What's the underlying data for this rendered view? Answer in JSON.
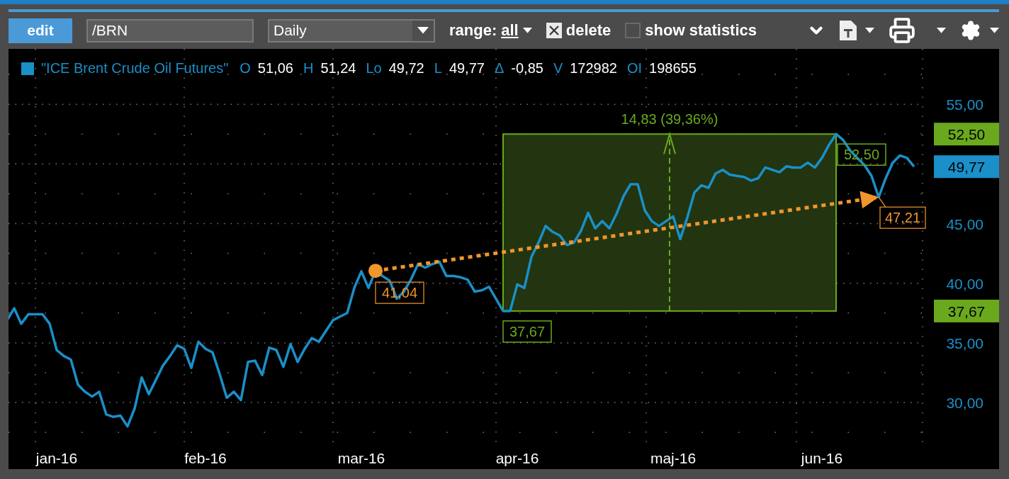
{
  "toolbar": {
    "edit_button": "edit",
    "symbol": {
      "value": "/BRN"
    },
    "interval": {
      "value": "Daily"
    },
    "range": {
      "label": "range:",
      "value": "all"
    },
    "delete": {
      "label": "delete",
      "checked": true
    },
    "show_statistics": {
      "label": "show statistics",
      "checked": false
    }
  },
  "chart": {
    "legend": {
      "color": "#1a8fc8",
      "stats": [
        {
          "key": "O",
          "value": "51,06"
        },
        {
          "key": "H",
          "value": "51,24"
        },
        {
          "key": "Lo",
          "value": "49,72"
        },
        {
          "key": "L",
          "value": "49,77"
        },
        {
          "key": "Δ",
          "value": "-0,85"
        },
        {
          "key": "V",
          "value": "172982"
        },
        {
          "key": "OI",
          "value": "198655"
        }
      ]
    },
    "price_tags": [
      {
        "label": "52,50",
        "color": "#6aa81e"
      },
      {
        "label": "49,77",
        "color": "#1a8fc8"
      },
      {
        "label": "37,67",
        "color": "#6aa81e"
      }
    ],
    "chart_data": {
      "type": "line",
      "grid": true,
      "ylim": [
        26.5,
        59.64
      ],
      "yticks": [
        {
          "value": 30,
          "label": "30,00"
        },
        {
          "value": 35,
          "label": "35,00"
        },
        {
          "value": 40,
          "label": "40,00"
        },
        {
          "value": 45,
          "label": "45,00"
        },
        {
          "value": 55,
          "label": "55,00"
        }
      ],
      "categories": [
        null,
        null,
        null,
        null,
        null,
        null,
        null,
        "jan-16",
        null,
        null,
        null,
        null,
        null,
        null,
        null,
        null,
        null,
        null,
        null,
        null,
        null,
        null,
        null,
        null,
        null,
        null,
        null,
        null,
        "feb-16",
        null,
        null,
        null,
        null,
        null,
        null,
        null,
        null,
        null,
        null,
        null,
        null,
        null,
        null,
        null,
        null,
        null,
        null,
        null,
        null,
        null,
        "mar-16",
        null,
        null,
        null,
        null,
        null,
        null,
        null,
        null,
        null,
        null,
        null,
        null,
        null,
        null,
        null,
        null,
        null,
        null,
        null,
        null,
        null,
        "apr-16",
        null,
        null,
        null,
        null,
        null,
        null,
        null,
        null,
        null,
        null,
        null,
        null,
        null,
        null,
        null,
        null,
        null,
        null,
        null,
        null,
        null,
        "maj-16",
        null,
        null,
        null,
        null,
        null,
        null,
        null,
        null,
        null,
        null,
        null,
        null,
        null,
        null,
        null,
        null,
        null,
        null,
        null,
        null,
        "jun-16",
        null,
        null,
        null,
        null,
        null,
        null,
        null,
        null,
        null,
        null,
        null,
        null,
        null
      ],
      "series": [
        {
          "name": "\"ICE Brent Crude Oil Futures\"",
          "color": "#1a8fc8",
          "values": [
            36.9,
            37.9,
            36.6,
            37.4,
            37.4,
            37.4,
            36.6,
            34.4,
            33.9,
            33.6,
            31.5,
            30.9,
            30.5,
            30.9,
            29.0,
            28.8,
            28.9,
            28.0,
            29.5,
            32.1,
            30.7,
            31.9,
            33.1,
            33.9,
            34.8,
            34.5,
            32.9,
            35.1,
            34.5,
            34.2,
            32.4,
            30.4,
            30.9,
            30.2,
            33.4,
            33.5,
            32.3,
            34.6,
            34.4,
            33.0,
            34.9,
            33.4,
            34.5,
            35.4,
            35.1,
            36.0,
            36.9,
            37.2,
            37.5,
            39.6,
            41.0,
            39.6,
            41.04,
            40.6,
            40.2,
            38.7,
            39.3,
            40.3,
            41.6,
            41.3,
            41.6,
            41.8,
            40.6,
            40.6,
            40.5,
            40.3,
            39.3,
            39.4,
            39.7,
            38.7,
            37.67,
            37.67,
            39.9,
            39.6,
            42.2,
            43.4,
            44.8,
            44.3,
            44.0,
            43.2,
            43.4,
            44.4,
            45.9,
            44.6,
            45.2,
            44.6,
            45.8,
            47.3,
            48.3,
            48.3,
            46.1,
            45.2,
            44.8,
            45.2,
            45.6,
            43.7,
            45.5,
            47.6,
            48.2,
            48.0,
            49.2,
            49.5,
            49.1,
            49.0,
            48.9,
            48.6,
            48.8,
            49.7,
            49.5,
            49.3,
            49.8,
            49.7,
            49.7,
            50.1,
            49.7,
            50.5,
            51.6,
            52.5,
            52.0,
            51.1,
            50.5,
            49.9,
            49.0,
            47.21,
            48.8,
            50.1,
            50.7,
            50.5,
            49.77
          ]
        }
      ],
      "annotations": [
        "37,67",
        "52,50",
        "14,83 (39,36%)",
        "41,04",
        "47,21"
      ]
    }
  }
}
